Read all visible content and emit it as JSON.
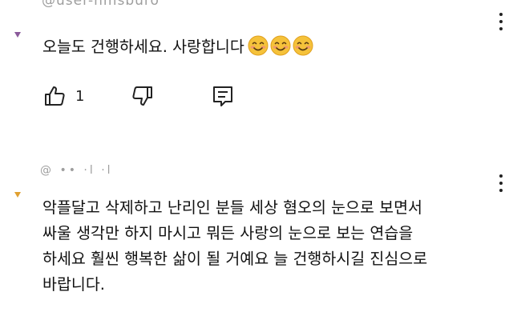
{
  "comments": [
    {
      "handle_cut": "@user-hmsburo",
      "text": "오늘도  건행하세요. 사랑합니다",
      "emojis": [
        "smiling-face-icon",
        "smiling-face-icon",
        "smiling-face-icon"
      ],
      "like_count": "1",
      "avatar_accent": "#8a5a9a"
    },
    {
      "handle_cut": "@ •• ·l ·l",
      "text": "악플달고 삭제하고 난리인 분들 세상 혐오의 눈으로 보면서\n싸울 생각만 하지 마시고 뭐든 사랑의 눈으로 보는 연습을\n하세요 훨씬 행복한 삶이 될 거예요 늘 건행하시길 진심으로\n바랍니다.",
      "avatar_accent": "#e0a030"
    }
  ],
  "colors": {
    "emoji_face": "#f5c23a",
    "emoji_blush": "#f29a6a",
    "text": "#111111",
    "icon": "#222222"
  }
}
